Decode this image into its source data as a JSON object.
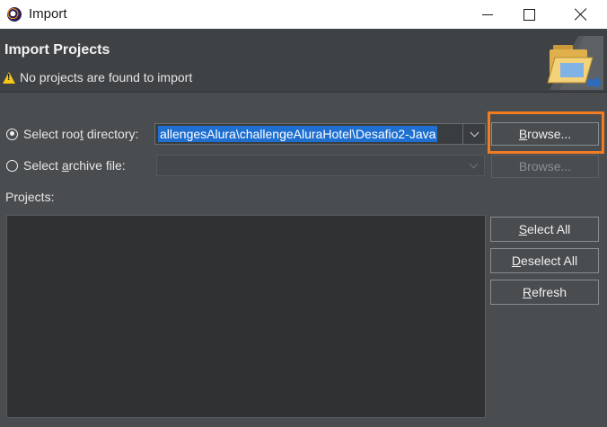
{
  "window": {
    "title": "Import"
  },
  "banner": {
    "title": "Import Projects",
    "message": "No projects are found to import"
  },
  "root_directory": {
    "label_pre": "Select roo",
    "label_ul": "t",
    "label_post": " directory:",
    "value": "allengesAlura\\challengeAluraHotel\\Desafio2-Java",
    "selected": true
  },
  "archive_file": {
    "label_pre": "Select ",
    "label_ul": "a",
    "label_post": "rchive file:",
    "value": "",
    "selected": false
  },
  "buttons": {
    "browse_root_ul": "B",
    "browse_root_rest": "rowse...",
    "browse_archive": "Browse...",
    "select_all_ul": "S",
    "select_all_rest": "elect All",
    "deselect_all_ul": "D",
    "deselect_all_rest": "eselect All",
    "refresh_ul": "R",
    "refresh_rest": "efresh"
  },
  "projects": {
    "label": "Projects:"
  },
  "colors": {
    "accent_highlight": "#f47c20",
    "selection": "#1e6fd0",
    "warning": "#f5c518"
  }
}
